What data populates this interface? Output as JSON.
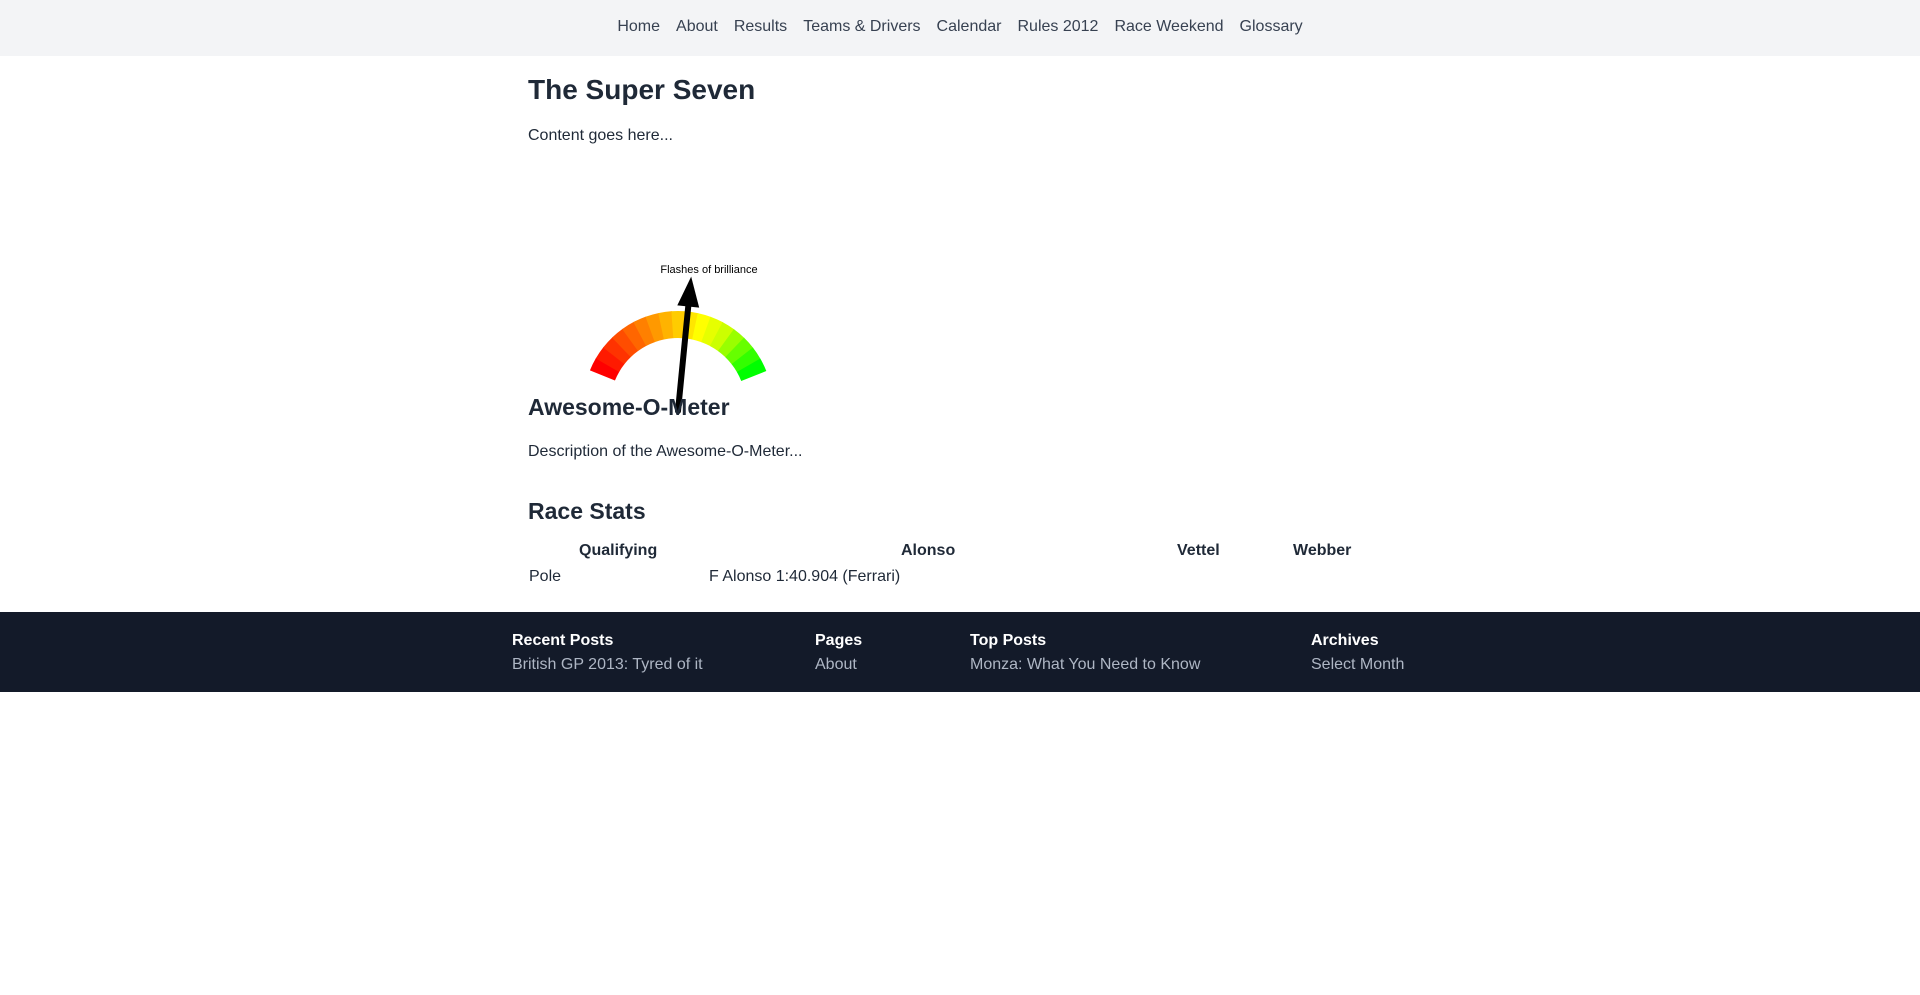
{
  "nav": {
    "items": [
      "Home",
      "About",
      "Results",
      "Teams & Drivers",
      "Calendar",
      "Rules 2012",
      "Race Weekend",
      "Glossary"
    ]
  },
  "page": {
    "title": "The Super Seven",
    "content": "Content goes here..."
  },
  "gauge": {
    "label": "Flashes of brilliance",
    "value_fraction": 0.6,
    "colors": [
      "#ff0000",
      "#ff1a00",
      "#ff3300",
      "#ff4d00",
      "#ff6600",
      "#ff8000",
      "#ff9900",
      "#ffb300",
      "#ffcc00",
      "#ffe600",
      "#ffff00",
      "#e6ff00",
      "#ccff00",
      "#99ff00",
      "#66ff00",
      "#33ff00",
      "#00ff00"
    ]
  },
  "meter": {
    "title": "Awesome-O-Meter",
    "description": "Description of the Awesome-O-Meter..."
  },
  "stats": {
    "title": "Race Stats",
    "headers": [
      "Qualifying",
      "Alonso",
      "Vettel",
      "Webber"
    ],
    "rows": [
      [
        "Pole",
        "F Alonso 1:40.904 (Ferrari)",
        "",
        ""
      ]
    ]
  },
  "footer": {
    "columns": [
      {
        "heading": "Recent Posts",
        "link": "British GP 2013: Tyred of it"
      },
      {
        "heading": "Pages",
        "link": "About"
      },
      {
        "heading": "Top Posts",
        "link": "Monza: What You Need to Know"
      },
      {
        "heading": "Archives",
        "link": "Select Month"
      }
    ]
  }
}
